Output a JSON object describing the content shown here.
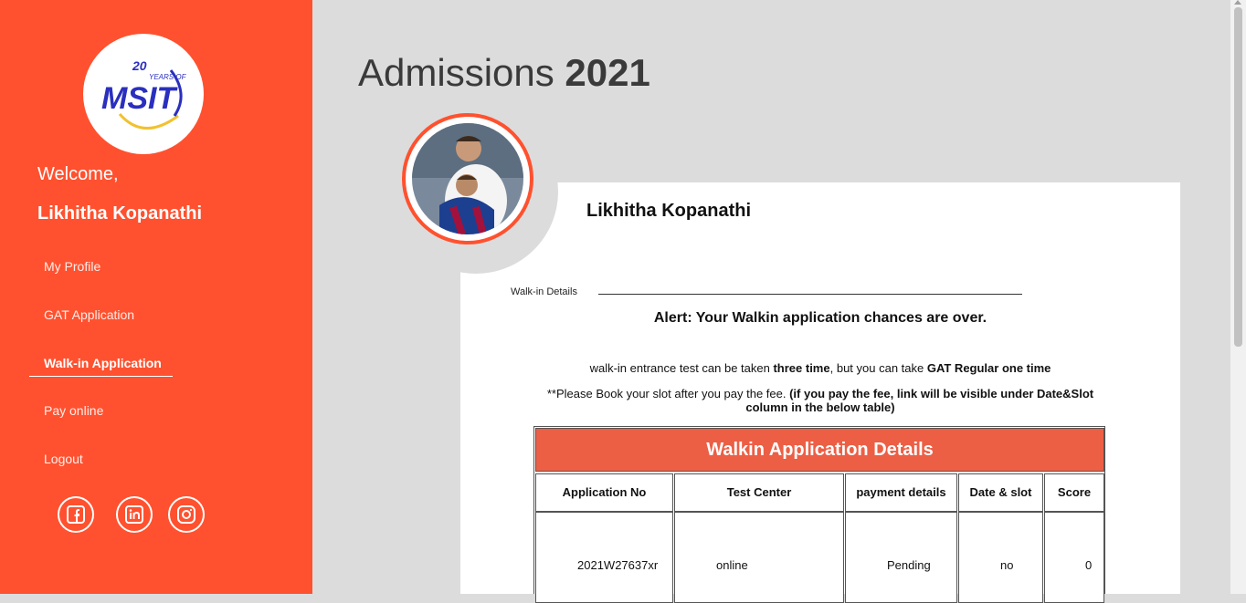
{
  "sidebar": {
    "logo": {
      "text": "MSIT",
      "tagline_number": "20",
      "tagline_text": "YEARS OF"
    },
    "welcome": "Welcome,",
    "username": "Likhitha Kopanathi",
    "nav": [
      {
        "label": "My Profile",
        "active": false
      },
      {
        "label": "GAT Application",
        "active": false
      },
      {
        "label": "Walk-in Application",
        "active": true
      },
      {
        "label": "Pay online",
        "active": false
      },
      {
        "label": "Logout",
        "active": false
      }
    ],
    "social": [
      "facebook-icon",
      "linkedin-icon",
      "instagram-icon"
    ]
  },
  "main": {
    "title_text": "Admissions",
    "title_year": "2021",
    "profile_name": "Likhitha Kopanathi",
    "section_label": "Walk-in Details",
    "alert": "Alert: Your Walkin application chances are over.",
    "info1": {
      "part1": "walk-in entrance test can be taken ",
      "bold1": "three time",
      "part2": ", but you can take ",
      "bold2": "GAT Regular one time"
    },
    "info2": {
      "part1": "**Please Book your slot after you pay the fee. ",
      "bold1": "(if you pay the fee, link will be visible under Date&Slot column in the below table)"
    },
    "table": {
      "title": "Walkin Application Details",
      "headers": [
        "Application No",
        "Test Center",
        "payment details",
        "Date & slot",
        "Score"
      ],
      "rows": [
        [
          "2021W27637xr",
          "online",
          "Pending",
          "no",
          "0"
        ]
      ]
    }
  },
  "colors": {
    "sidebar": "#ff512f",
    "table_header": "#ec5f45",
    "background": "#dcdcdc",
    "logo_blue": "#2a2fbf"
  }
}
